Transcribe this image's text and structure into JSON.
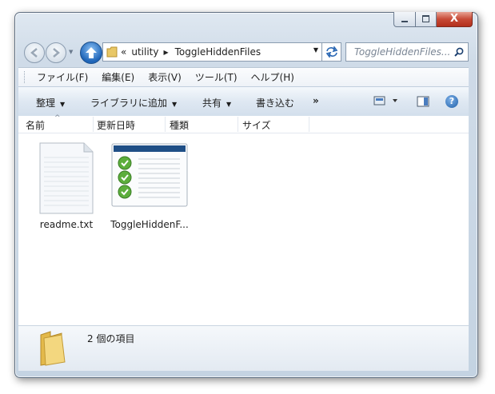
{
  "window": {
    "controls": {
      "minimize": "minimize",
      "maximize": "maximize",
      "close": "X"
    }
  },
  "address": {
    "overflow": "«",
    "path": [
      "utility",
      "ToggleHiddenFiles"
    ]
  },
  "search": {
    "placeholder": "ToggleHiddenFiles..."
  },
  "menu": [
    "ファイル(F)",
    "編集(E)",
    "表示(V)",
    "ツール(T)",
    "ヘルプ(H)"
  ],
  "toolbar": {
    "organize": "整理",
    "library": "ライブラリに追加",
    "share": "共有",
    "burn": "書き込む",
    "more": "»"
  },
  "columns": [
    "名前",
    "更新日時",
    "種類",
    "サイズ"
  ],
  "files": [
    {
      "name": "readme.txt",
      "icon": "text-file-icon"
    },
    {
      "name": "ToggleHiddenF...",
      "icon": "application-icon"
    }
  ],
  "details": {
    "summary": "2 個の項目"
  },
  "colors": {
    "accent": "#1e64b7",
    "close": "#c74a36",
    "frame": "#cfdbe8"
  }
}
